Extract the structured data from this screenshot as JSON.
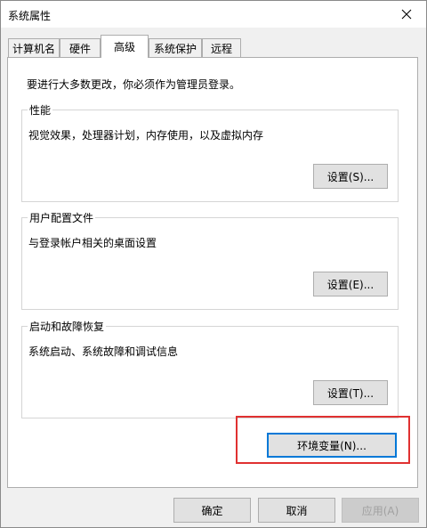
{
  "window": {
    "title": "系统属性",
    "close_icon": "close-icon"
  },
  "tabs": [
    {
      "label": "计算机名",
      "active": false
    },
    {
      "label": "硬件",
      "active": false
    },
    {
      "label": "高级",
      "active": true
    },
    {
      "label": "系统保护",
      "active": false
    },
    {
      "label": "远程",
      "active": false
    }
  ],
  "advanced": {
    "intro": "要进行大多数更改，你必须作为管理员登录。",
    "performance": {
      "title": "性能",
      "description": "视觉效果，处理器计划，内存使用，以及虚拟内存",
      "button": "设置(S)..."
    },
    "user_profiles": {
      "title": "用户配置文件",
      "description": "与登录帐户相关的桌面设置",
      "button": "设置(E)..."
    },
    "startup_recovery": {
      "title": "启动和故障恢复",
      "description": "系统启动、系统故障和调试信息",
      "button": "设置(T)..."
    },
    "env_button": "环境变量(N)..."
  },
  "footer": {
    "ok": "确定",
    "cancel": "取消",
    "apply": "应用(A)"
  },
  "colors": {
    "highlight": "#e03131",
    "focus": "#0078d7"
  }
}
